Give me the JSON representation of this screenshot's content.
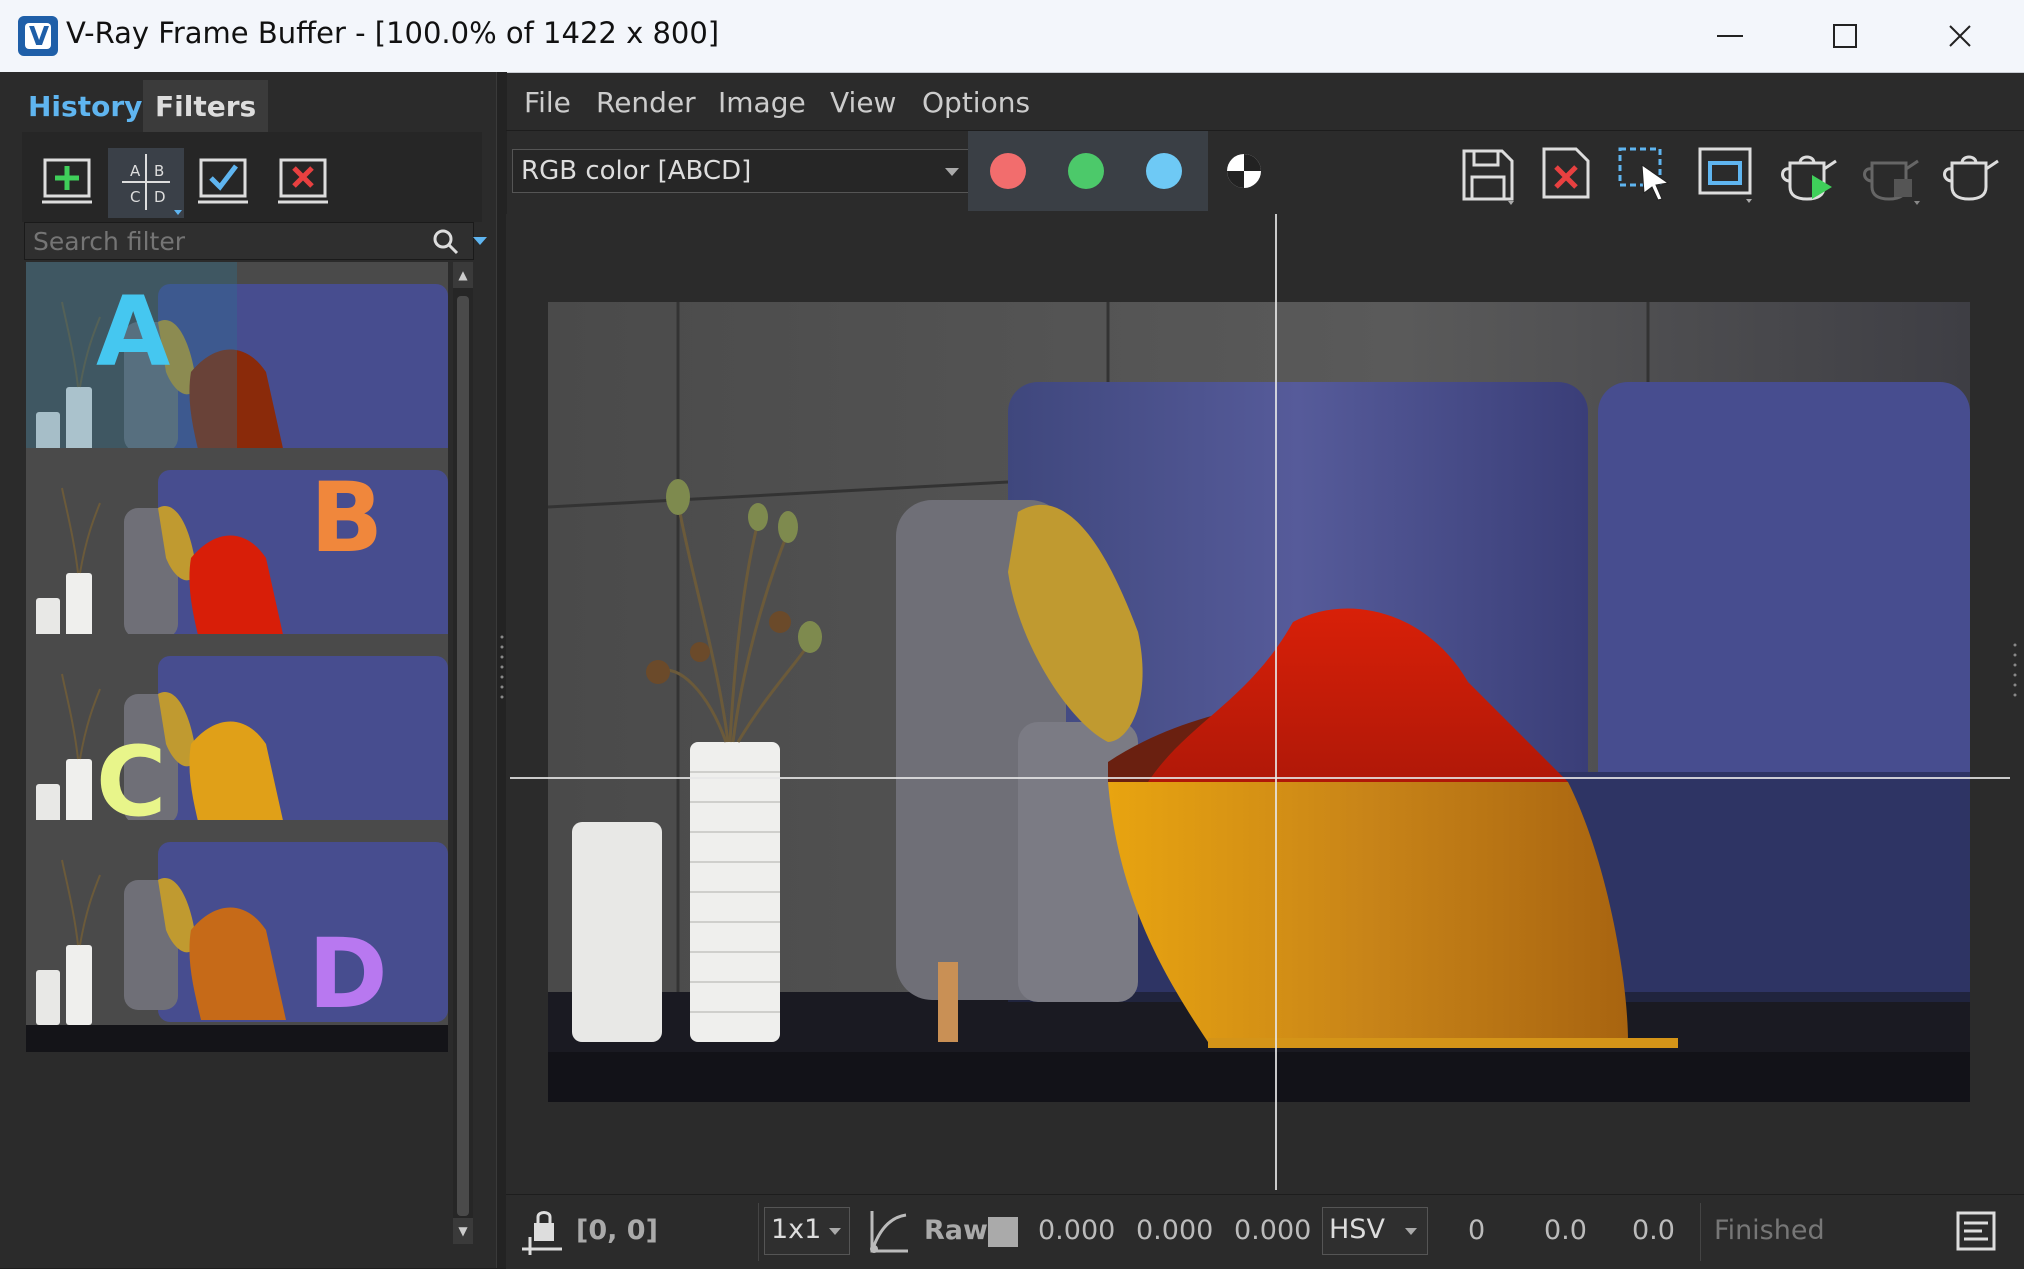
{
  "window": {
    "title": "V-Ray Frame Buffer - [100.0% of 1422 x 800]",
    "logo_letter": "V"
  },
  "left_panel": {
    "tabs": [
      {
        "label": "History"
      },
      {
        "label": "Filters"
      }
    ],
    "toolbar_icons": [
      "add-history-icon",
      "ab-compare-icon",
      "load-history-icon",
      "remove-history-icon"
    ],
    "compare_grid": [
      "A",
      "B",
      "C",
      "D"
    ],
    "search": {
      "placeholder": "Search filter"
    },
    "history_items": [
      {
        "label": "A",
        "label_color": "#45c7f0",
        "throw_color": "#8a2a0a"
      },
      {
        "label": "B",
        "label_color": "#f0873c",
        "throw_color": "#d81e08"
      },
      {
        "label": "C",
        "label_color": "#e8f58a",
        "throw_color": "#e0a018"
      },
      {
        "label": "D",
        "label_color": "#b878f0",
        "throw_color": "#c66a18"
      }
    ]
  },
  "menubar": {
    "items": [
      "File",
      "Render",
      "Image",
      "View",
      "Options"
    ]
  },
  "toolbar": {
    "channel": "RGB color [ABCD]",
    "channel_buttons": [
      {
        "name": "red-channel-button",
        "color": "#f26d6d"
      },
      {
        "name": "green-channel-button",
        "color": "#4cc96a"
      },
      {
        "name": "blue-channel-button",
        "color": "#6ec9f5"
      }
    ],
    "right_icons": [
      "save-image-icon",
      "clear-image-icon",
      "region-render-icon",
      "render-region-frame-icon",
      "start-interactive-render-icon",
      "stop-render-icon",
      "render-teapot-icon"
    ]
  },
  "status": {
    "coords": "[0, 0]",
    "sample_size": "1x1",
    "mode": "Raw",
    "rgb_values": [
      "0.000",
      "0.000",
      "0.000"
    ],
    "color_space": "HSV",
    "hsv_values": [
      "0",
      "0.0",
      "0.0"
    ],
    "state": "Finished"
  },
  "colors": {
    "accent": "#5fb5f0",
    "panel": "#2b2b2b"
  }
}
